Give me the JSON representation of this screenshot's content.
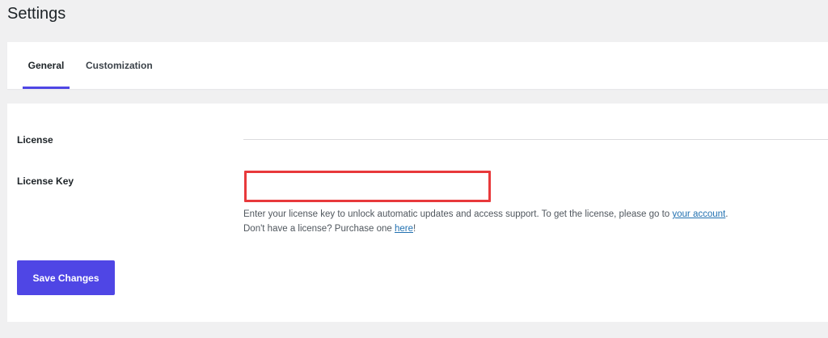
{
  "page": {
    "title": "Settings"
  },
  "tabs": [
    {
      "label": "General",
      "active": true
    },
    {
      "label": "Customization",
      "active": false
    }
  ],
  "license_section": {
    "label": "License"
  },
  "license_key": {
    "label": "License Key",
    "value": "",
    "placeholder": "",
    "help_line_1_prefix": "Enter your license key to unlock automatic updates and access support. To get the license, please go to ",
    "help_line_1_link": "your account",
    "help_line_1_suffix": ".",
    "help_line_2_prefix": "Don't have a license? Purchase one ",
    "help_line_2_link": "here",
    "help_line_2_suffix": "!"
  },
  "actions": {
    "save_label": "Save Changes"
  },
  "colors": {
    "accent": "#4f46e5",
    "input_highlight_border": "#e8393b",
    "link": "#2271b1",
    "page_background": "#f0f0f1"
  }
}
